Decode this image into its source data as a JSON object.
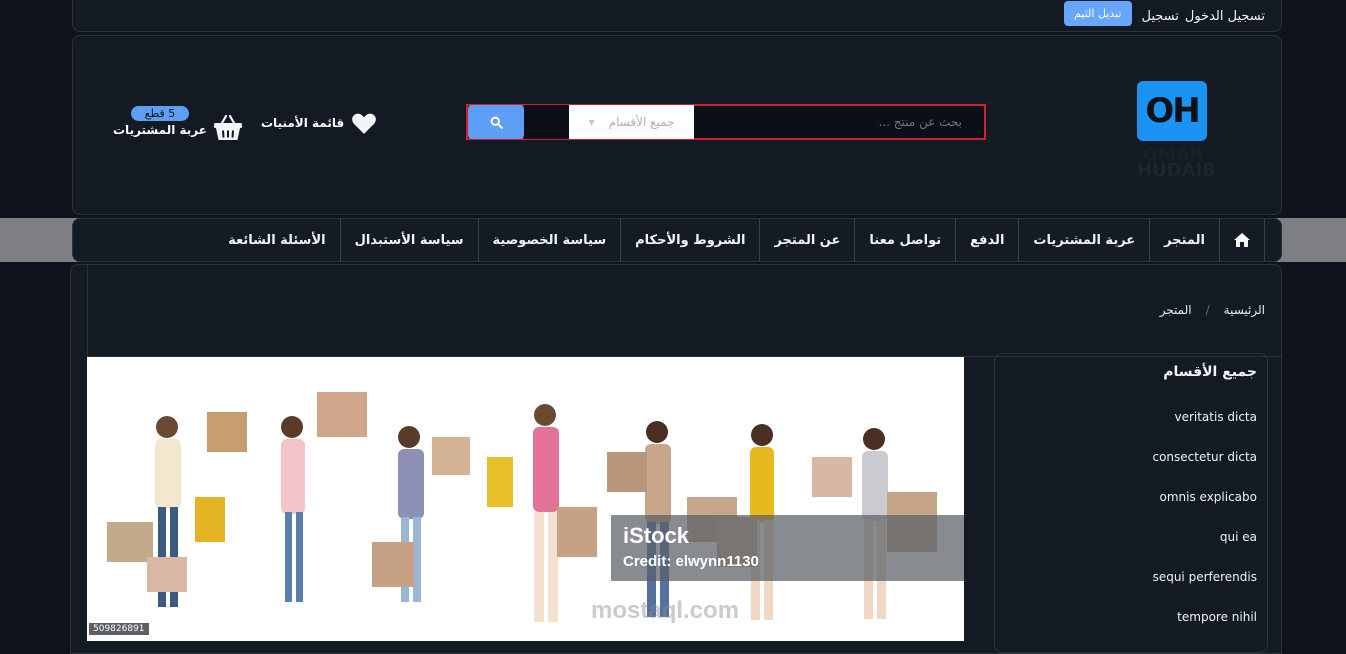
{
  "topbar": {
    "login": "تسجيل الدخول",
    "register": "تسجيل",
    "theme_toggle": "تبديل الثيم"
  },
  "header": {
    "logo_initials": "OH",
    "logo_line1": "OMAR",
    "logo_line2": "HUDAIB",
    "search": {
      "placeholder": "بحث عن منتج ...",
      "category_selected": "جميع الأقسام"
    },
    "wishlist_label": "قائمة الأمنيات",
    "cart": {
      "badge": "5 قطع",
      "label": "عربة المشتريات"
    }
  },
  "nav": {
    "items": [
      {
        "label": "المتجر"
      },
      {
        "label": "عربة المشتريات"
      },
      {
        "label": "الدفع"
      },
      {
        "label": "تواصل معنا"
      },
      {
        "label": "عن المتجر"
      },
      {
        "label": "الشروط والأحكام"
      },
      {
        "label": "سياسة الخصوصية"
      },
      {
        "label": "سياسة الأستبدال"
      },
      {
        "label": "الأسئلة الشائعة"
      }
    ]
  },
  "breadcrumb": {
    "home": "الرئيسية",
    "sep": "/",
    "current": "المتجر"
  },
  "banner": {
    "brand": "iStock",
    "credit": "Credit: elwynn1130",
    "image_id": "509826891",
    "watermark": "mostaql.com"
  },
  "sidebar": {
    "title": "جميع الأقسام",
    "categories": [
      "veritatis dicta",
      "consectetur dicta",
      "omnis explicabo",
      "qui ea",
      "sequi perferendis",
      "tempore nihil"
    ]
  },
  "colors": {
    "accent": "#5d9ff6",
    "logo_blue": "#1b93f2",
    "search_outline": "#d21f2f",
    "background": "#0f141c"
  }
}
